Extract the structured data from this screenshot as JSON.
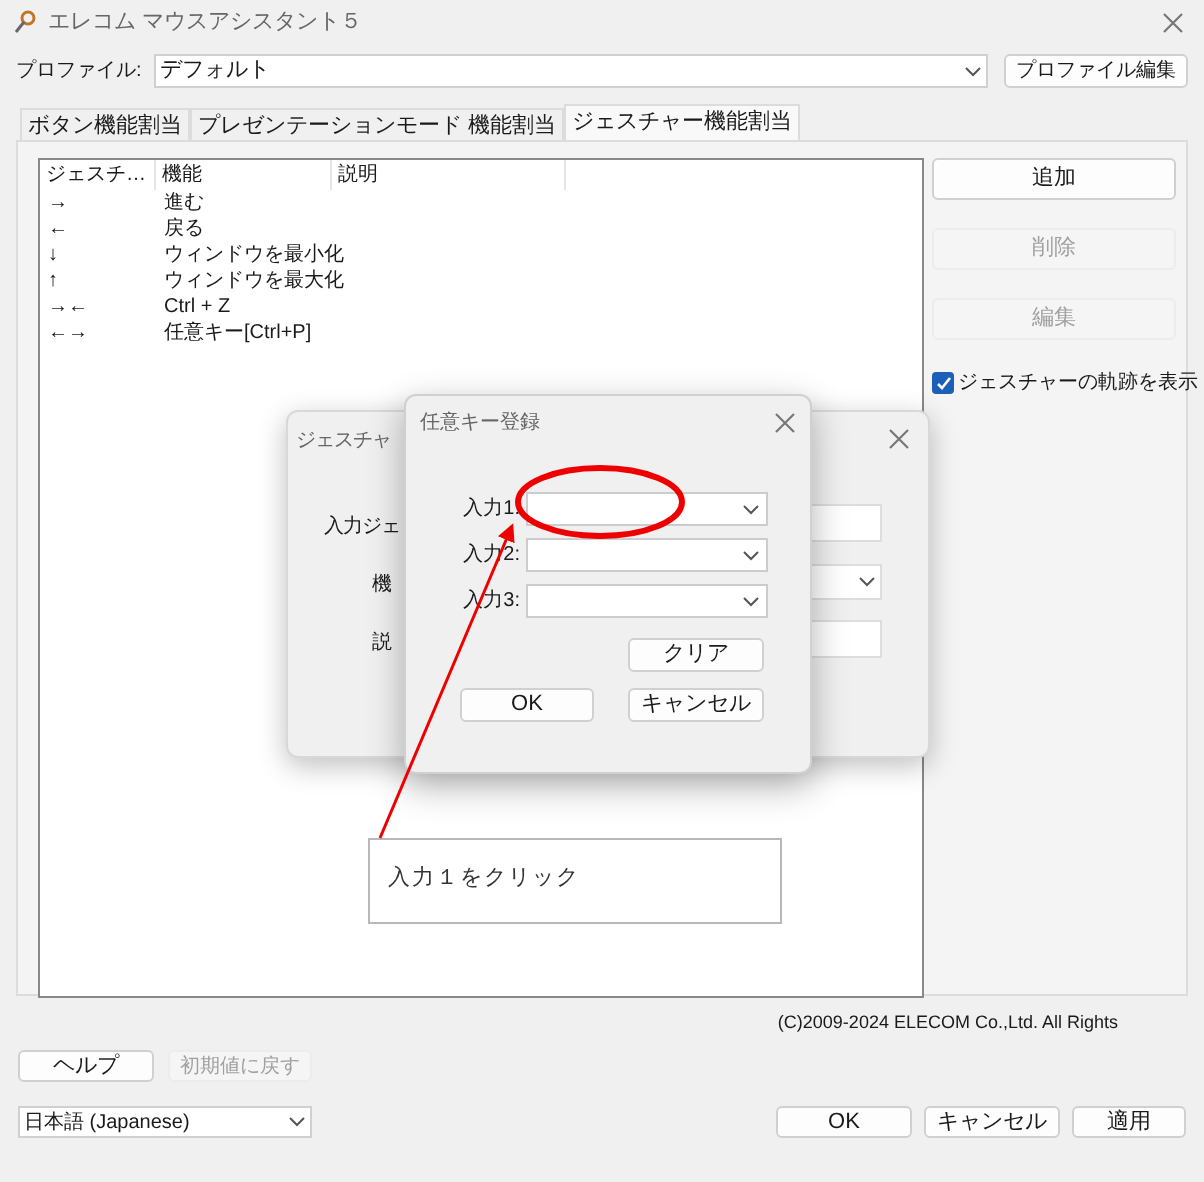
{
  "window": {
    "title": "エレコム マウスアシスタント５"
  },
  "profile": {
    "label": "プロファイル:",
    "value": "デフォルト",
    "edit_button": "プロファイル編集"
  },
  "tabs": [
    {
      "label": "ボタン機能割当",
      "selected": false
    },
    {
      "label": "プレゼンテーションモード 機能割当",
      "selected": false
    },
    {
      "label": "ジェスチャー機能割当",
      "selected": true
    }
  ],
  "gesture_list": {
    "columns": [
      "ジェスチ…",
      "機能",
      "説明"
    ],
    "rows": [
      {
        "gesture": "→",
        "function": "進む"
      },
      {
        "gesture": "←",
        "function": "戻る"
      },
      {
        "gesture": "↓",
        "function": "ウィンドウを最小化"
      },
      {
        "gesture": "↑",
        "function": "ウィンドウを最大化"
      },
      {
        "gesture": "→←",
        "function": "Ctrl + Z"
      },
      {
        "gesture": "←→",
        "function": "任意キー[Ctrl+P]"
      }
    ]
  },
  "side_buttons": [
    {
      "label": "追加",
      "disabled": false
    },
    {
      "label": "削除",
      "disabled": true
    },
    {
      "label": "編集",
      "disabled": true
    }
  ],
  "show_trail": {
    "label": "ジェスチャーの軌跡を表示",
    "checked": true
  },
  "copyright": "(C)2009-2024 ELECOM Co.,Ltd. All Rights",
  "help_button": {
    "label": "ヘルプ",
    "disabled": false
  },
  "reset_button": {
    "label": "初期値に戻す",
    "disabled": true
  },
  "language": "日本語 (Japanese)",
  "footer_buttons": [
    "OK",
    "キャンセル",
    "適用"
  ],
  "back_dialog": {
    "title": "ジェスチャ",
    "labels": [
      "入力ジェ",
      "機",
      "説"
    ]
  },
  "key_dialog": {
    "title": "任意キー登録",
    "inputs": [
      "入力1:",
      "入力2:",
      "入力3:"
    ],
    "clear_button": "クリア",
    "ok_button": "OK",
    "cancel_button": "キャンセル"
  },
  "annotation": "入力１をクリック"
}
